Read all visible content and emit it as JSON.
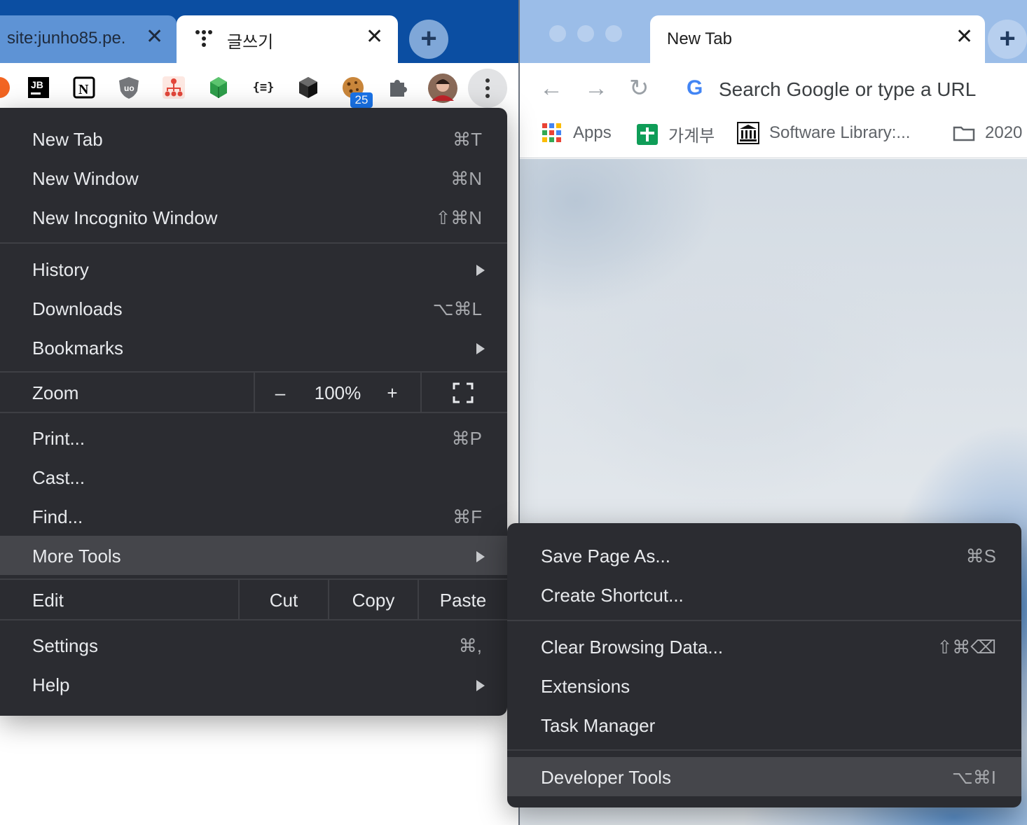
{
  "left_window": {
    "tabs": [
      {
        "title": "site:junho85.pe.",
        "close": "✕"
      },
      {
        "title": "글쓰기",
        "close": "✕"
      }
    ],
    "new_tab_symbol": "+",
    "extensions": [
      "firefox-like-icon",
      "jetbrains-icon",
      "notion-icon",
      "ublock-icon",
      "tree-icon",
      "green-cube-icon",
      "json-viewer-icon",
      "black-cube-icon",
      "cookie-icon",
      "puzzle-icon",
      "avatar",
      "kebab-menu-icon"
    ],
    "json_ext_label": "{≡}",
    "badge_count": "25"
  },
  "right_window": {
    "tab_title": "New Tab",
    "tab_close": "✕",
    "new_tab_symbol": "+",
    "nav": {
      "back": "←",
      "forward": "→",
      "reload": "↻"
    },
    "omnibox": {
      "g": "G",
      "placeholder": "Search Google or type a URL"
    },
    "bookmarks": [
      {
        "label": "Apps",
        "icon": "apps-grid-icon"
      },
      {
        "label": "가계부",
        "icon": "sheets-icon"
      },
      {
        "label": "Software Library:...",
        "icon": "library-icon"
      },
      {
        "label": "2020",
        "icon": "folder-icon"
      }
    ]
  },
  "main_menu": {
    "items": [
      {
        "label": "New Tab",
        "shortcut": "⌘T"
      },
      {
        "label": "New Window",
        "shortcut": "⌘N"
      },
      {
        "label": "New Incognito Window",
        "shortcut": "⇧⌘N"
      },
      {
        "label": "History",
        "shortcut": ""
      },
      {
        "label": "Downloads",
        "shortcut": "⌥⌘L"
      },
      {
        "label": "Bookmarks",
        "shortcut": ""
      },
      {
        "label": "Print...",
        "shortcut": "⌘P"
      },
      {
        "label": "Cast...",
        "shortcut": ""
      },
      {
        "label": "Find...",
        "shortcut": "⌘F"
      },
      {
        "label": "More Tools",
        "shortcut": ""
      },
      {
        "label": "Settings",
        "shortcut": "⌘,"
      },
      {
        "label": "Help",
        "shortcut": ""
      }
    ],
    "zoom": {
      "label": "Zoom",
      "minus": "–",
      "value": "100%",
      "plus": "+"
    },
    "edit": {
      "label": "Edit",
      "cut": "Cut",
      "copy": "Copy",
      "paste": "Paste"
    }
  },
  "sub_menu": {
    "items": [
      {
        "label": "Save Page As...",
        "shortcut": "⌘S"
      },
      {
        "label": "Create Shortcut...",
        "shortcut": ""
      },
      {
        "label": "Clear Browsing Data...",
        "shortcut": "⇧⌘⌫"
      },
      {
        "label": "Extensions",
        "shortcut": ""
      },
      {
        "label": "Task Manager",
        "shortcut": ""
      },
      {
        "label": "Developer Tools",
        "shortcut": "⌥⌘I"
      }
    ]
  },
  "colors": {
    "left_tabstrip": "#0b4ea2",
    "menu_bg": "#2b2c31",
    "menu_highlight": "#45464b",
    "badge": "#1a73e8"
  }
}
